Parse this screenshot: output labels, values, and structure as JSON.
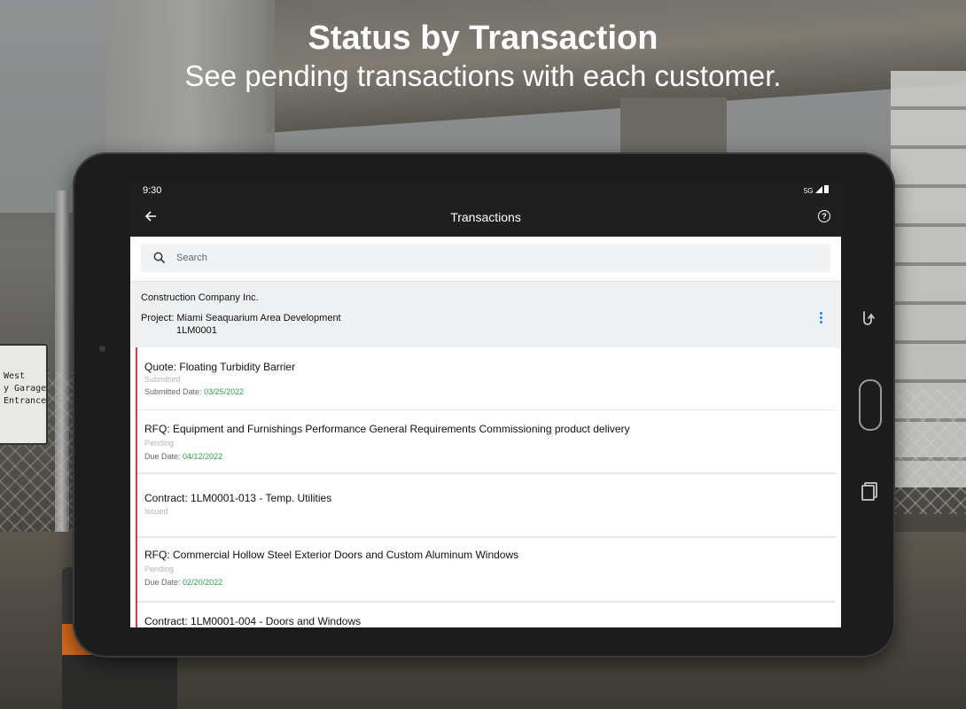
{
  "headline": {
    "title": "Status by Transaction",
    "subtitle": "See pending transactions with each customer."
  },
  "background": {
    "sign_lines": [
      "West",
      "y Garage",
      "Entrance"
    ]
  },
  "device": {
    "status_time": "9:30",
    "signal": "5G"
  },
  "appbar": {
    "title": "Transactions",
    "back_icon": "arrow-left-icon",
    "help_icon": "help-circle-icon"
  },
  "search": {
    "placeholder": "Search",
    "value": ""
  },
  "project": {
    "company": "Construction Company Inc.",
    "label": "Project:",
    "name": "Miami Seaquarium Area Development",
    "code": "1LM0001"
  },
  "colors": {
    "accent": "#1e88e5",
    "status_bar": "#1f1f1f",
    "date_green": "#2e9e48",
    "indicator_red": "#e53935"
  },
  "transactions": [
    {
      "title": "Quote: Floating Turbidity Barrier",
      "status": "Submitted",
      "date_label": "Submitted Date:",
      "date": "03/25/2022"
    },
    {
      "title": "RFQ: Equipment and Furnishings Performance General Requirements Commissioning product delivery",
      "status": "Pending",
      "date_label": "Due Date:",
      "date": "04/12/2022"
    },
    {
      "title": "Contract: 1LM0001-013 -  Temp. Utilities",
      "status": "Issued",
      "date_label": "",
      "date": ""
    },
    {
      "title": "RFQ: Commercial Hollow Steel Exterior Doors and Custom Aluminum Windows",
      "status": "Pending",
      "date_label": "Due Date:",
      "date": "02/20/2022"
    },
    {
      "title": "Contract: 1LM0001-004 - Doors and Windows",
      "status": "",
      "date_label": "",
      "date": ""
    }
  ]
}
